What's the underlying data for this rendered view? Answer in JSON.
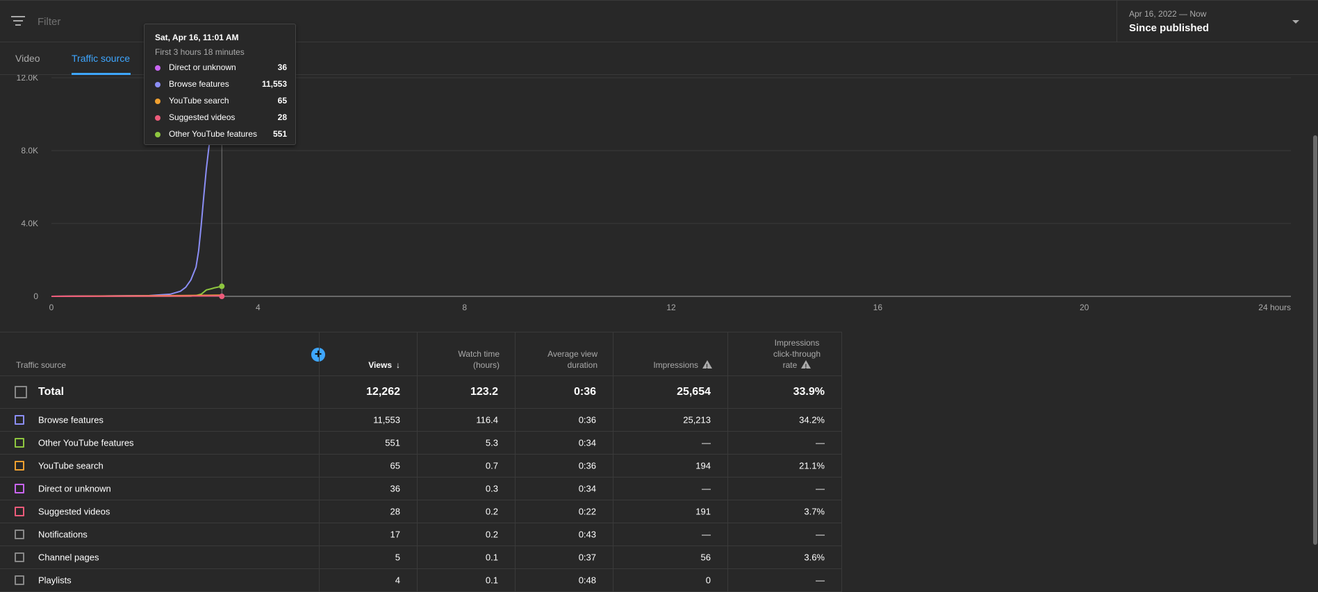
{
  "filter": {
    "placeholder": "Filter"
  },
  "date_picker": {
    "range": "Apr 16, 2022 — Now",
    "label": "Since published"
  },
  "tabs": [
    {
      "label": "Video"
    },
    {
      "label": "Traffic source"
    }
  ],
  "tooltip": {
    "title": "Sat, Apr 16, 11:01 AM",
    "subtitle": "First 3 hours 18 minutes",
    "items": [
      {
        "name": "Direct or unknown",
        "value": "36",
        "color": "#c965f3"
      },
      {
        "name": "Browse features",
        "value": "11,553",
        "color": "#8b8ef5"
      },
      {
        "name": "YouTube search",
        "value": "65",
        "color": "#f0a030"
      },
      {
        "name": "Suggested videos",
        "value": "28",
        "color": "#ec5b7a"
      },
      {
        "name": "Other YouTube features",
        "value": "551",
        "color": "#8ec63f"
      }
    ]
  },
  "chart_data": {
    "type": "line",
    "x_ticks": [
      "0",
      "4",
      "8",
      "12",
      "16",
      "20",
      "24 hours"
    ],
    "y_ticks": [
      "0",
      "4.0K",
      "8.0K",
      "12.0K"
    ],
    "xlim": [
      0,
      24
    ],
    "ylim": [
      0,
      12000
    ],
    "grid": true,
    "cursor_x": 3.3,
    "series": [
      {
        "color": "#8b8ef5",
        "points": [
          [
            0,
            0
          ],
          [
            1.9,
            40
          ],
          [
            2.3,
            120
          ],
          [
            2.5,
            280
          ],
          [
            2.6,
            500
          ],
          [
            2.7,
            900
          ],
          [
            2.8,
            1600
          ],
          [
            2.85,
            2500
          ],
          [
            2.9,
            3900
          ],
          [
            2.95,
            5500
          ],
          [
            3.0,
            7000
          ],
          [
            3.05,
            8200
          ],
          [
            3.1,
            9200
          ],
          [
            3.15,
            10400
          ],
          [
            3.2,
            11553
          ]
        ]
      },
      {
        "color": "#8ec63f",
        "points": [
          [
            0,
            0
          ],
          [
            2.7,
            10
          ],
          [
            2.8,
            40
          ],
          [
            2.9,
            120
          ],
          [
            3.0,
            350
          ],
          [
            3.1,
            420
          ],
          [
            3.15,
            460
          ],
          [
            3.3,
            551
          ]
        ]
      },
      {
        "color": "#c965f3",
        "points": [
          [
            0,
            0
          ],
          [
            1.0,
            20
          ],
          [
            2.0,
            28
          ],
          [
            3.3,
            36
          ]
        ]
      },
      {
        "color": "#f0a030",
        "points": [
          [
            0,
            0
          ],
          [
            2.5,
            40
          ],
          [
            3.3,
            65
          ]
        ]
      },
      {
        "color": "#ec5b7a",
        "points": [
          [
            0,
            0
          ],
          [
            2.5,
            15
          ],
          [
            3.3,
            28
          ]
        ]
      }
    ]
  },
  "table": {
    "headers": {
      "source": "Traffic source",
      "views": "Views",
      "watch_1": "Watch time",
      "watch_2": "(hours)",
      "avg_1": "Average view",
      "avg_2": "duration",
      "impressions": "Impressions",
      "ctr_1": "Impressions",
      "ctr_2": "click-through",
      "ctr_3": "rate"
    },
    "total": {
      "name": "Total",
      "views": "12,262",
      "watch": "123.2",
      "avg": "0:36",
      "impressions": "25,654",
      "ctr": "33.9%"
    },
    "rows": [
      {
        "name": "Browse features",
        "color": "#8b8ef5",
        "views": "11,553",
        "watch": "116.4",
        "avg": "0:36",
        "impressions": "25,213",
        "ctr": "34.2%"
      },
      {
        "name": "Other YouTube features",
        "color": "#8ec63f",
        "views": "551",
        "watch": "5.3",
        "avg": "0:34",
        "impressions": "—",
        "ctr": "—"
      },
      {
        "name": "YouTube search",
        "color": "#f0a030",
        "views": "65",
        "watch": "0.7",
        "avg": "0:36",
        "impressions": "194",
        "ctr": "21.1%"
      },
      {
        "name": "Direct or unknown",
        "color": "#c965f3",
        "views": "36",
        "watch": "0.3",
        "avg": "0:34",
        "impressions": "—",
        "ctr": "—"
      },
      {
        "name": "Suggested videos",
        "color": "#ec5b7a",
        "views": "28",
        "watch": "0.2",
        "avg": "0:22",
        "impressions": "191",
        "ctr": "3.7%"
      },
      {
        "name": "Notifications",
        "color": "#888888",
        "views": "17",
        "watch": "0.2",
        "avg": "0:43",
        "impressions": "—",
        "ctr": "—"
      },
      {
        "name": "Channel pages",
        "color": "#888888",
        "views": "5",
        "watch": "0.1",
        "avg": "0:37",
        "impressions": "56",
        "ctr": "3.6%"
      },
      {
        "name": "Playlists",
        "color": "#888888",
        "views": "4",
        "watch": "0.1",
        "avg": "0:48",
        "impressions": "0",
        "ctr": "—"
      }
    ]
  }
}
